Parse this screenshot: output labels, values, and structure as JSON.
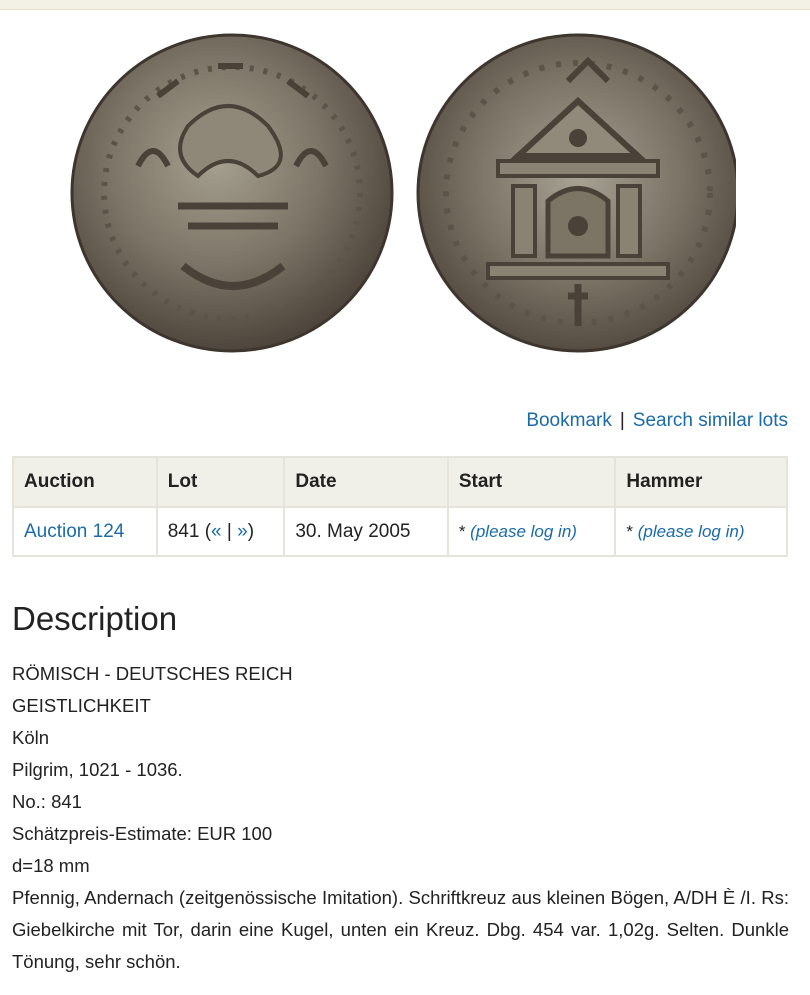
{
  "links": {
    "bookmark": "Bookmark",
    "separator": "|",
    "search_similar": "Search similar lots"
  },
  "table": {
    "headers": [
      "Auction",
      "Lot",
      "Date",
      "Start",
      "Hammer"
    ],
    "row": {
      "auction": "Auction 124",
      "lot_number": "841",
      "lot_open": " (",
      "prev": "«",
      "lot_sep": " | ",
      "next": "»",
      "lot_close": ")",
      "date": "30. May 2005",
      "start_prefix": "* ",
      "start_link": "(please log in)",
      "hammer_prefix": "* ",
      "hammer_link": "(please log in)"
    }
  },
  "description": {
    "title": "Description",
    "lines": [
      "RÖMISCH - DEUTSCHES REICH",
      "GEISTLICHKEIT",
      "Köln",
      "Pilgrim, 1021 - 1036.",
      "No.: 841",
      "Schätzpreis-Estimate: EUR 100",
      "d=18 mm"
    ],
    "paragraph": "Pfennig, Andernach (zeitgenössische Imitation). Schriftkreuz aus kleinen Bögen, A/DH È /I. Rs: Giebelkirche mit Tor, darin eine Kugel, unten ein Kreuz. Dbg. 454 var. 1,02g. Selten. Dunkle Tönung, sehr schön."
  }
}
